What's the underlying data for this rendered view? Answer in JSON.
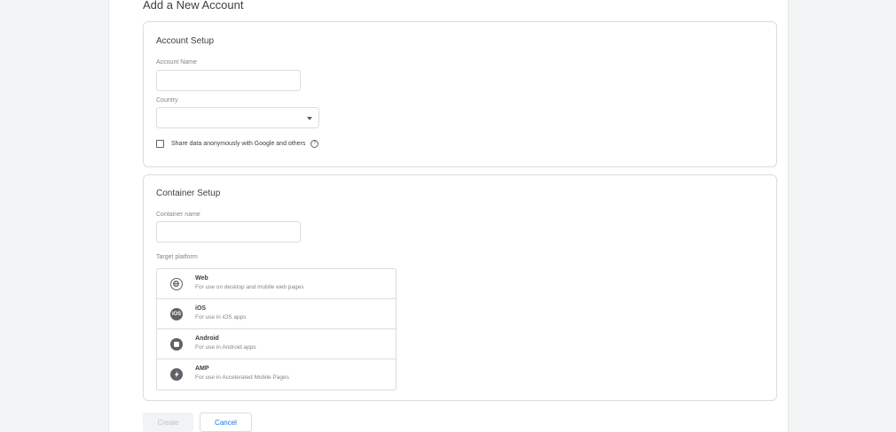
{
  "page": {
    "title": "Add a New Account"
  },
  "account_setup": {
    "title": "Account Setup",
    "account_name_label": "Account Name",
    "account_name_value": "",
    "country_label": "Country",
    "country_value": "",
    "share_data_label": "Share data anonymously with Google and others",
    "share_data_checked": false,
    "help_icon": "help-circle-icon"
  },
  "container_setup": {
    "title": "Container Setup",
    "container_name_label": "Container name",
    "container_name_value": "",
    "target_platform_label": "Target platform",
    "platforms": [
      {
        "name": "Web",
        "description": "For use on desktop and mobile web pages",
        "icon": "globe-icon"
      },
      {
        "name": "iOS",
        "description": "For use in iOS apps",
        "icon": "ios-icon"
      },
      {
        "name": "Android",
        "description": "For use in Android apps",
        "icon": "android-icon"
      },
      {
        "name": "AMP",
        "description": "For use in Accelerated Mobile Pages",
        "icon": "lightning-icon"
      }
    ]
  },
  "actions": {
    "create_label": "Create",
    "cancel_label": "Cancel"
  },
  "colors": {
    "accent": "#1a73e8",
    "border": "#dadce0",
    "background": "#f1f3f4"
  }
}
